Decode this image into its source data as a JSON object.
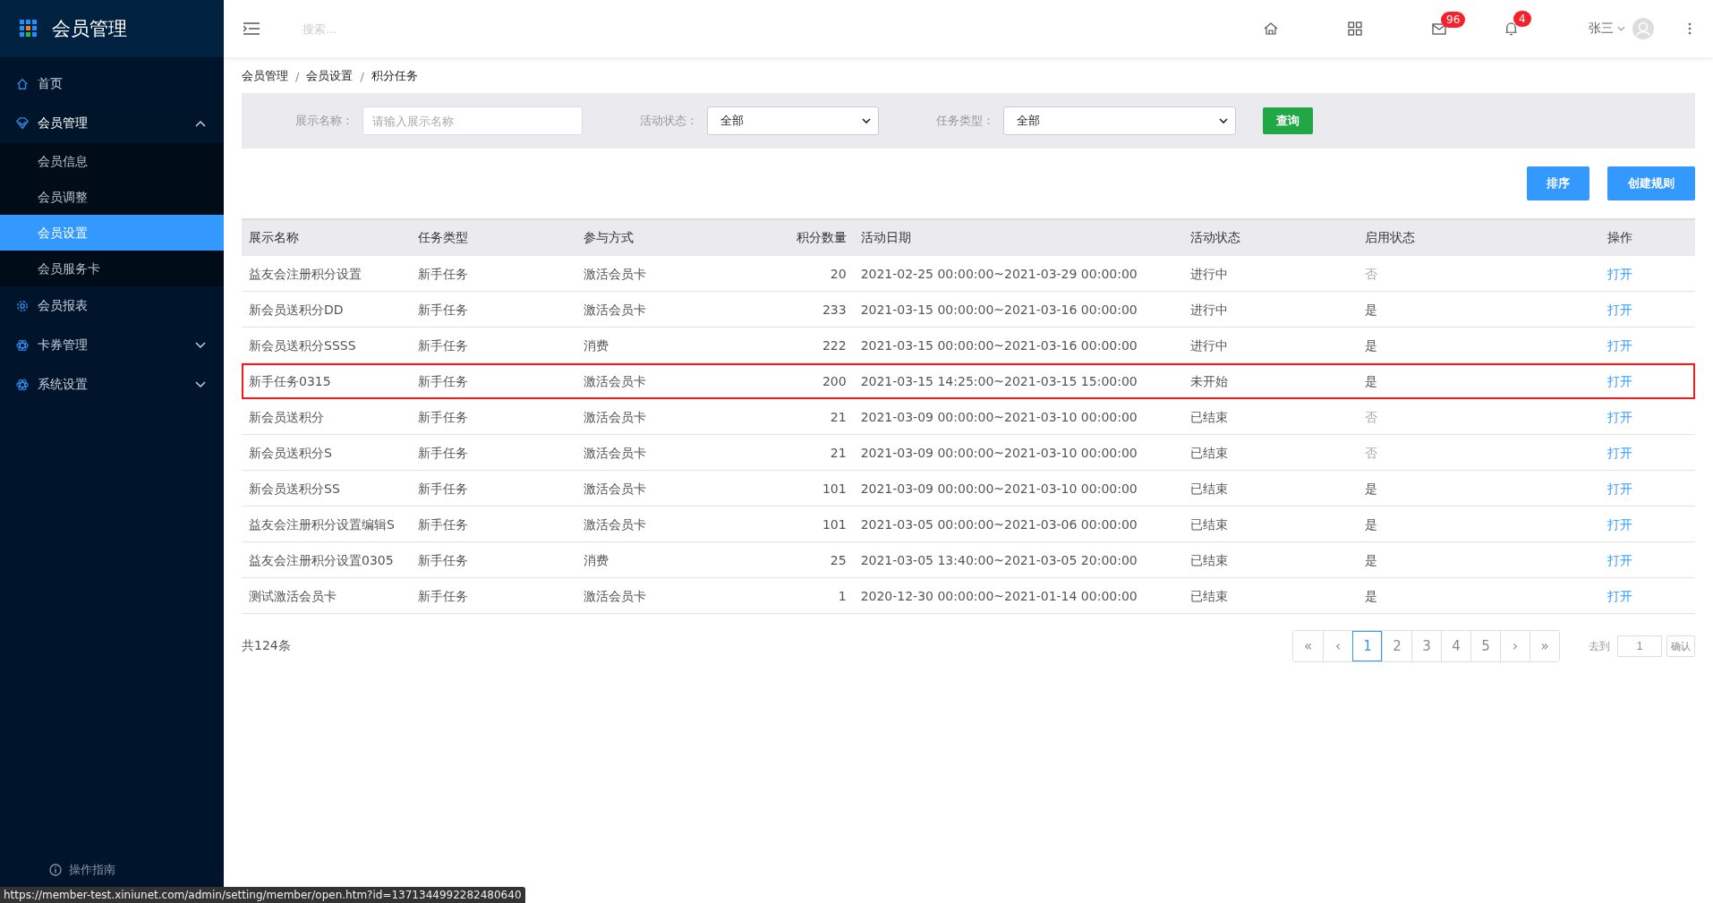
{
  "sidebar": {
    "title": "会员管理",
    "items": [
      {
        "label": "首页",
        "kind": "home"
      },
      {
        "label": "会员管理",
        "kind": "member",
        "expanded": true,
        "children": [
          {
            "label": "会员信息",
            "selected": false
          },
          {
            "label": "会员调整",
            "selected": false
          },
          {
            "label": "会员设置",
            "selected": true
          },
          {
            "label": "会员服务卡",
            "selected": false
          }
        ]
      },
      {
        "label": "会员报表",
        "kind": "gear"
      },
      {
        "label": "卡券管理",
        "kind": "atom",
        "expanded": false
      },
      {
        "label": "系统设置",
        "kind": "atom",
        "expanded": false
      }
    ],
    "footer": "操作指南"
  },
  "header": {
    "search": {
      "placeholder": "搜索..."
    },
    "mail_badge": "96",
    "bell_badge": "4",
    "user": "张三"
  },
  "breadcrumb": [
    "会员管理",
    "/",
    "会员设置",
    "/",
    "积分任务"
  ],
  "filters": {
    "name_label": "展示名称：",
    "name_placeholder": "请输入展示名称",
    "status_label": "活动状态：",
    "status_value": "全部",
    "type_label": "任务类型：",
    "type_value": "全部",
    "query": "查询"
  },
  "actions": [
    "排序",
    "创建规则"
  ],
  "table": {
    "columns": [
      "展示名称",
      "任务类型",
      "参与方式",
      "积分数量",
      "活动日期",
      "活动状态",
      "启用状态",
      "操作"
    ],
    "rows": [
      {
        "name": "益友会注册积分设置",
        "type": "新手任务",
        "method": "激活会员卡",
        "points": "20",
        "date": "2021-02-25 00:00:00~2021-03-29 00:00:00",
        "status": "进行中",
        "enabled_text": "否",
        "enabled": false,
        "action": "打开",
        "highlighted": false
      },
      {
        "name": "新会员送积分DD",
        "type": "新手任务",
        "method": "激活会员卡",
        "points": "233",
        "date": "2021-03-15 00:00:00~2021-03-16 00:00:00",
        "status": "进行中",
        "enabled_text": "是",
        "enabled": true,
        "action": "打开",
        "highlighted": false
      },
      {
        "name": "新会员送积分SSSS",
        "type": "新手任务",
        "method": "消费",
        "points": "222",
        "date": "2021-03-15 00:00:00~2021-03-16 00:00:00",
        "status": "进行中",
        "enabled_text": "是",
        "enabled": true,
        "action": "打开",
        "highlighted": false
      },
      {
        "name": "新手任务0315",
        "type": "新手任务",
        "method": "激活会员卡",
        "points": "200",
        "date": "2021-03-15 14:25:00~2021-03-15 15:00:00",
        "status": "未开始",
        "enabled_text": "是",
        "enabled": true,
        "action": "打开",
        "highlighted": true
      },
      {
        "name": "新会员送积分",
        "type": "新手任务",
        "method": "激活会员卡",
        "points": "21",
        "date": "2021-03-09 00:00:00~2021-03-10 00:00:00",
        "status": "已结束",
        "enabled_text": "否",
        "enabled": false,
        "action": "打开",
        "highlighted": false
      },
      {
        "name": "新会员送积分S",
        "type": "新手任务",
        "method": "激活会员卡",
        "points": "21",
        "date": "2021-03-09 00:00:00~2021-03-10 00:00:00",
        "status": "已结束",
        "enabled_text": "否",
        "enabled": false,
        "action": "打开",
        "highlighted": false
      },
      {
        "name": "新会员送积分SS",
        "type": "新手任务",
        "method": "激活会员卡",
        "points": "101",
        "date": "2021-03-09 00:00:00~2021-03-10 00:00:00",
        "status": "已结束",
        "enabled_text": "是",
        "enabled": true,
        "action": "打开",
        "highlighted": false
      },
      {
        "name": "益友会注册积分设置编辑S",
        "type": "新手任务",
        "method": "激活会员卡",
        "points": "101",
        "date": "2021-03-05 00:00:00~2021-03-06 00:00:00",
        "status": "已结束",
        "enabled_text": "是",
        "enabled": true,
        "action": "打开",
        "highlighted": false
      },
      {
        "name": "益友会注册积分设置0305",
        "type": "新手任务",
        "method": "消费",
        "points": "25",
        "date": "2021-03-05 13:40:00~2021-03-05 20:00:00",
        "status": "已结束",
        "enabled_text": "是",
        "enabled": true,
        "action": "打开",
        "highlighted": false
      },
      {
        "name": "测试激活会员卡",
        "type": "新手任务",
        "method": "激活会员卡",
        "points": "1",
        "date": "2020-12-30 00:00:00~2021-01-14 00:00:00",
        "status": "已结束",
        "enabled_text": "是",
        "enabled": true,
        "action": "打开",
        "highlighted": false
      }
    ]
  },
  "total": "共124条",
  "pagination": {
    "first": "«",
    "prev": "‹",
    "pages": [
      {
        "label": "1",
        "selected": true
      },
      {
        "label": "2",
        "selected": false
      },
      {
        "label": "3",
        "selected": false
      },
      {
        "label": "4",
        "selected": false
      },
      {
        "label": "5",
        "selected": false
      }
    ],
    "next": "›",
    "last": "»",
    "goto_label": "去到",
    "goto_value": "1",
    "confirm": "确认"
  },
  "status_url": "https://member-test.xiniunet.com/admin/setting/member/open.htm?id=1371344992282480640"
}
